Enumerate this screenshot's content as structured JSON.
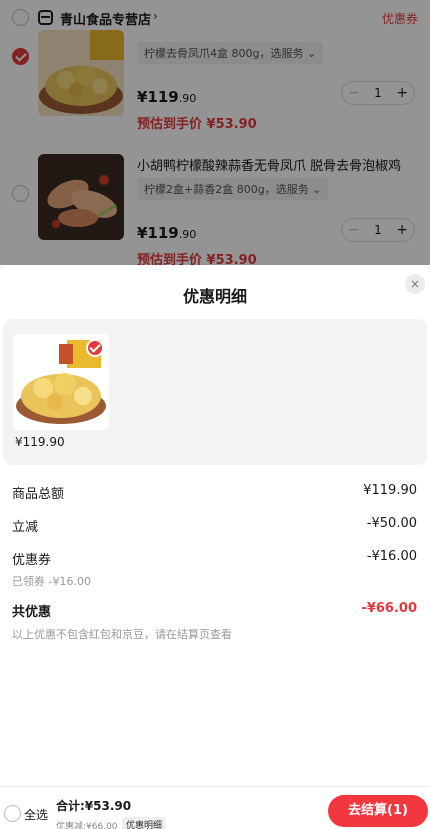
{
  "cart": {
    "store": {
      "name": "青山食品专营店",
      "arrow": "›",
      "coupon_label": "优惠券",
      "icon": "store-icon"
    },
    "items": [
      {
        "spec": "柠檬去骨凤爪4盒 800g，选服务 ⌄",
        "price": "¥119",
        "price_cents": ".90",
        "estimated_label": "预估到手价 ¥53.90",
        "quantity": "1",
        "selected": true
      },
      {
        "title": "小胡鸭柠檬酸辣蒜香无骨凤爪 脱骨去骨泡椒鸡",
        "spec": "柠檬2盒+蒜香2盒 800g，选服务 ⌄",
        "price": "¥119",
        "price_cents": ".90",
        "estimated_label": "预估到手价 ¥53.90",
        "quantity": "1",
        "selected": false
      }
    ],
    "stepper": {
      "minus": "−",
      "plus": "+"
    }
  },
  "sheet": {
    "title": "优惠明细",
    "close_icon": "×",
    "product_price": "¥119.90",
    "rows": [
      {
        "label": "商品总额",
        "value": "¥119.90"
      },
      {
        "label": "立减",
        "value": "-¥50.00"
      },
      {
        "label": "优惠券",
        "value": "-¥16.00",
        "sub": "已领券 -¥16.00"
      },
      {
        "label": "共优惠",
        "value": "-¥66.00"
      }
    ],
    "note": "以上优惠不包含红包和京豆，请在结算页查看"
  },
  "bottom_bar": {
    "select_all": "全选",
    "total": "合计:¥53.90",
    "saved": "优惠减:¥66.00",
    "detail_chip": "优惠明细",
    "checkout": "去结算(1)"
  },
  "colors": {
    "accent": "#e4393c",
    "overlay": "rgba(0,0,0,0.42)"
  }
}
